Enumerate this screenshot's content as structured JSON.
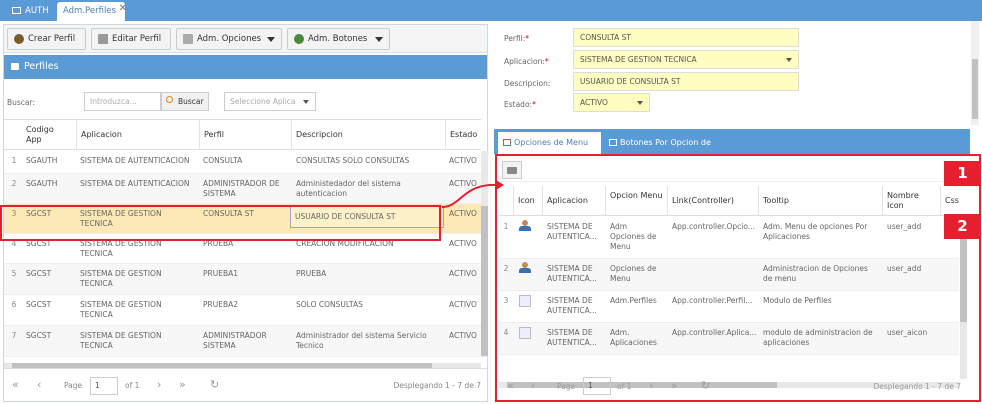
{
  "tabs": [
    {
      "label": "AUTH"
    },
    {
      "label": "Adm.Perfiles"
    }
  ],
  "left": {
    "toolbar": {
      "crear": "Crear Perfil",
      "editar": "Editar Perfil",
      "opciones": "Adm. Opciones",
      "botones": "Adm. Botones"
    },
    "panel_title": "Perfiles",
    "search": {
      "label": "Buscar:",
      "placeholder": "Introduzca...",
      "button": "Buscar",
      "select_placeholder": "Seleccione Aplica"
    },
    "columns": {
      "codigo": "Codigo App",
      "aplicacion": "Aplicacion",
      "perfil": "Perfil",
      "descripcion": "Descripcion",
      "estado": "Estado"
    },
    "rows": [
      {
        "n": "1",
        "codigo": "SGAUTH",
        "aplicacion": "SISTEMA DE AUTENTICACION",
        "perfil": "CONSULTA",
        "descripcion": "CONSULTAS SOLO CONSULTAS",
        "estado": "ACTIVO"
      },
      {
        "n": "2",
        "codigo": "SGAUTH",
        "aplicacion": "SISTEMA DE AUTENTICACION",
        "perfil": "ADMINISTRADOR DE SISTEMA",
        "descripcion": "Administedador del sistema autenticacion",
        "estado": "ACTIVO"
      },
      {
        "n": "3",
        "codigo": "SGCST",
        "aplicacion": "SISTEMA DE GESTION TECNICA",
        "perfil": "CONSULTA ST",
        "descripcion": "USUARIO DE CONSULTA ST",
        "estado": "ACTIVO"
      },
      {
        "n": "4",
        "codigo": "SGCST",
        "aplicacion": "SISTEMA DE GESTION TECNICA",
        "perfil": "PRUEBA",
        "descripcion": "CREACION MODIFICACION",
        "estado": "ACTIVO"
      },
      {
        "n": "5",
        "codigo": "SGCST",
        "aplicacion": "SISTEMA DE GESTION TECNICA",
        "perfil": "PRUEBA1",
        "descripcion": "PRUEBA",
        "estado": "ACTIVO"
      },
      {
        "n": "6",
        "codigo": "SGCST",
        "aplicacion": "SISTEMA DE GESTION TECNICA",
        "perfil": "PRUEBA2",
        "descripcion": "SOLO CONSULTAS",
        "estado": "ACTIVO"
      },
      {
        "n": "7",
        "codigo": "SGCST",
        "aplicacion": "SISTEMA DE GESTION TECNICA",
        "perfil": "ADMINISTRADOR SISTEMA",
        "descripcion": "Administrador del sistema Servicio Tecnico",
        "estado": "ACTIVO"
      }
    ],
    "pager": {
      "page_label": "Page",
      "page_value": "1",
      "of": "of 1",
      "display": "Desplegando 1 - 7 de 7"
    }
  },
  "right": {
    "form": {
      "perfil_label": "Perfil:",
      "perfil_value": "CONSULTA ST",
      "aplicacion_label": "Aplicacion:",
      "aplicacion_value": "SISTEMA DE GESTION TECNICA",
      "descripcion_label": "Descripcion:",
      "descripcion_value": "USUARIO DE CONSULTA ST",
      "estado_label": "Estado:",
      "estado_value": "ACTIVO",
      "required_mark": "*"
    },
    "tabs": {
      "opciones": "Opciones de Menu",
      "botones": "Botones Por Opcion de Menu"
    },
    "columns": {
      "icon": "Icon",
      "aplicacion": "Aplicacion",
      "opcion": "Opcion Menu",
      "link": "Link(Controller)",
      "tooltip": "Tooltip",
      "nombre_icon": "Nombre Icon",
      "css": "Css"
    },
    "rows": [
      {
        "n": "1",
        "aplicacion": "SISTEMA DE AUTENTICA...",
        "opcion": "Adm Opciones de Menu",
        "link": "App.controller.Opcio...",
        "tooltip": "Adm. Menu de opciones Por Aplicaciones",
        "nombre_icon": "user_add"
      },
      {
        "n": "2",
        "aplicacion": "SISTEMA DE AUTENTICA...",
        "opcion": "Opciones de Menu",
        "link": "",
        "tooltip": "Administracion de Opciones de menu",
        "nombre_icon": "user_add"
      },
      {
        "n": "3",
        "aplicacion": "SISTEMA DE AUTENTICA...",
        "opcion": "Adm.Perfiles",
        "link": "App.controller.Perfil...",
        "tooltip": "Modulo de Perfiles",
        "nombre_icon": ""
      },
      {
        "n": "4",
        "aplicacion": "SISTEMA DE AUTENTICA...",
        "opcion": "Adm. Aplicaciones",
        "link": "App.controller.Aplica...",
        "tooltip": "modulo de administracion de aplicaciones",
        "nombre_icon": "user_aicon"
      }
    ],
    "pager": {
      "page_label": "Page",
      "page_value": "1",
      "of": "of 1",
      "display": "Desplegando 1 - 7 de 7"
    }
  },
  "badges": {
    "one": "1",
    "two": "2"
  },
  "colors": {
    "accent": "#5b9bd5",
    "highlight": "#e5202e",
    "selected_row": "#fce9b5",
    "field_bg": "#fffdc0"
  }
}
